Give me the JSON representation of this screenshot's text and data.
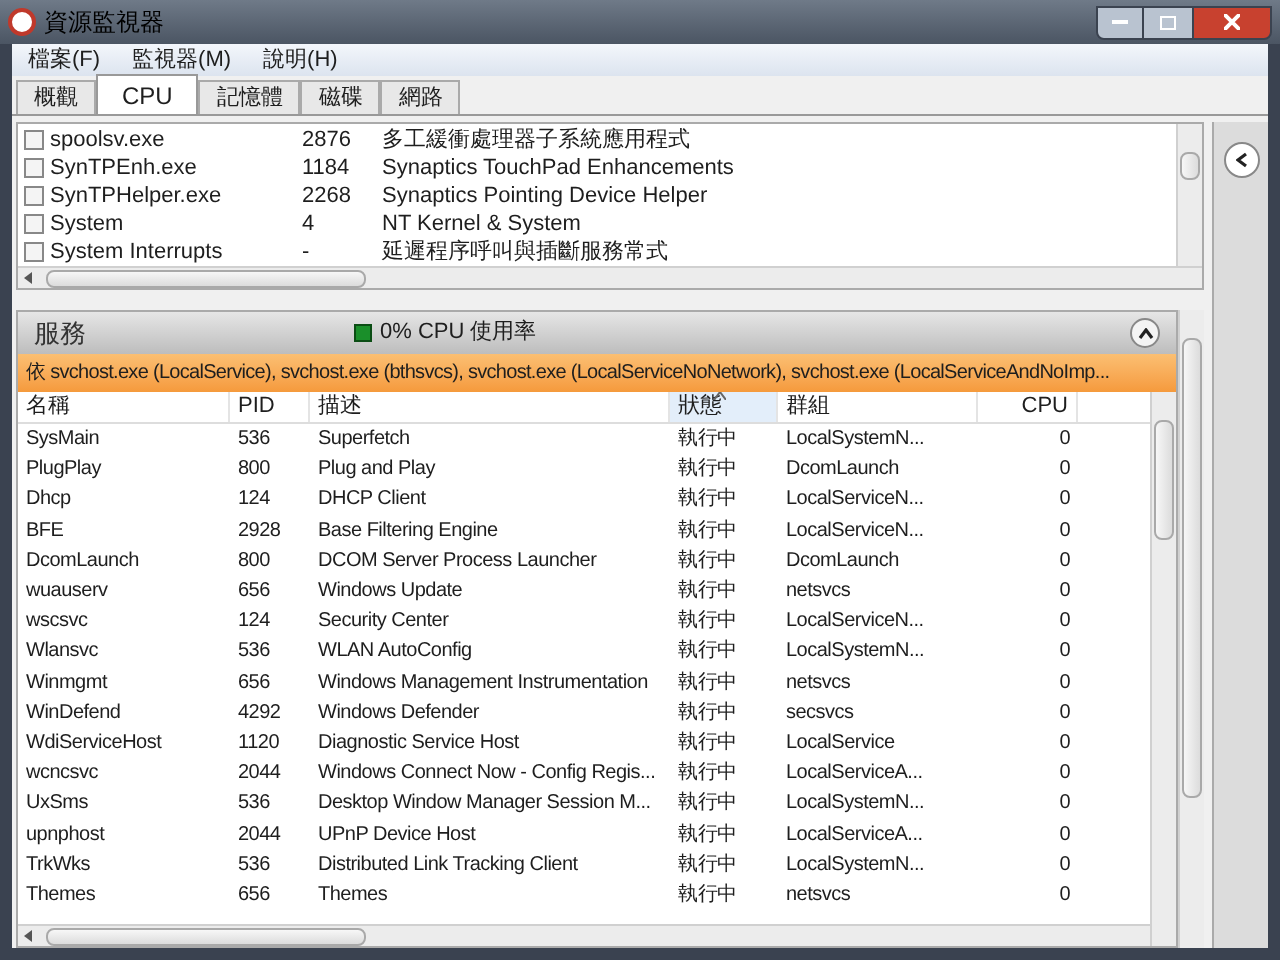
{
  "window": {
    "title": "資源監視器"
  },
  "menu": [
    "檔案(F)",
    "監視器(M)",
    "說明(H)"
  ],
  "tabs": [
    {
      "label": "概觀",
      "selected": false
    },
    {
      "label": "CPU",
      "selected": true
    },
    {
      "label": "記憶體",
      "selected": false
    },
    {
      "label": "磁碟",
      "selected": false
    },
    {
      "label": "網路",
      "selected": false
    }
  ],
  "processes": [
    {
      "name": "spoolsv.exe",
      "pid": "2876",
      "description": "多工緩衝處理器子系統應用程式",
      "checked": false
    },
    {
      "name": "SynTPEnh.exe",
      "pid": "1184",
      "description": "Synaptics TouchPad Enhancements",
      "checked": false
    },
    {
      "name": "SynTPHelper.exe",
      "pid": "2268",
      "description": "Synaptics Pointing Device Helper",
      "checked": false
    },
    {
      "name": "System",
      "pid": "4",
      "description": "NT Kernel & System",
      "checked": false
    },
    {
      "name": "System Interrupts",
      "pid": "-",
      "description": "延遲程序呼叫與插斷服務常式",
      "checked": false
    }
  ],
  "services": {
    "title": "服務",
    "usage": "0% CPU 使用率",
    "expanded": true,
    "filter": "依 svchost.exe (LocalService), svchost.exe (bthsvcs), svchost.exe (LocalServiceNoNetwork), svchost.exe (LocalServiceAndNoImp...",
    "columns": [
      {
        "label": "名稱",
        "sorted": false
      },
      {
        "label": "PID",
        "sorted": false
      },
      {
        "label": "描述",
        "sorted": false
      },
      {
        "label": "狀態",
        "sorted": true
      },
      {
        "label": "群組",
        "sorted": false
      },
      {
        "label": "CPU",
        "sorted": false
      }
    ],
    "rows": [
      [
        "SysMain",
        "536",
        "Superfetch",
        "執行中",
        "LocalSystemN...",
        "0"
      ],
      [
        "PlugPlay",
        "800",
        "Plug and Play",
        "執行中",
        "DcomLaunch",
        "0"
      ],
      [
        "Dhcp",
        "124",
        "DHCP Client",
        "執行中",
        "LocalServiceN...",
        "0"
      ],
      [
        "BFE",
        "2928",
        "Base Filtering Engine",
        "執行中",
        "LocalServiceN...",
        "0"
      ],
      [
        "DcomLaunch",
        "800",
        "DCOM Server Process Launcher",
        "執行中",
        "DcomLaunch",
        "0"
      ],
      [
        "wuauserv",
        "656",
        "Windows Update",
        "執行中",
        "netsvcs",
        "0"
      ],
      [
        "wscsvc",
        "124",
        "Security Center",
        "執行中",
        "LocalServiceN...",
        "0"
      ],
      [
        "Wlansvc",
        "536",
        "WLAN AutoConfig",
        "執行中",
        "LocalSystemN...",
        "0"
      ],
      [
        "Winmgmt",
        "656",
        "Windows Management Instrumentation",
        "執行中",
        "netsvcs",
        "0"
      ],
      [
        "WinDefend",
        "4292",
        "Windows Defender",
        "執行中",
        "secsvcs",
        "0"
      ],
      [
        "WdiServiceHost",
        "1120",
        "Diagnostic Service Host",
        "執行中",
        "LocalService",
        "0"
      ],
      [
        "wcncsvc",
        "2044",
        "Windows Connect Now - Config Regis...",
        "執行中",
        "LocalServiceA...",
        "0"
      ],
      [
        "UxSms",
        "536",
        "Desktop Window Manager Session M...",
        "執行中",
        "LocalSystemN...",
        "0"
      ],
      [
        "upnphost",
        "2044",
        "UPnP Device Host",
        "執行中",
        "LocalServiceA...",
        "0"
      ],
      [
        "TrkWks",
        "536",
        "Distributed Link Tracking Client",
        "執行中",
        "LocalSystemN...",
        "0"
      ],
      [
        "Themes",
        "656",
        "Themes",
        "執行中",
        "netsvcs",
        "0"
      ]
    ]
  }
}
